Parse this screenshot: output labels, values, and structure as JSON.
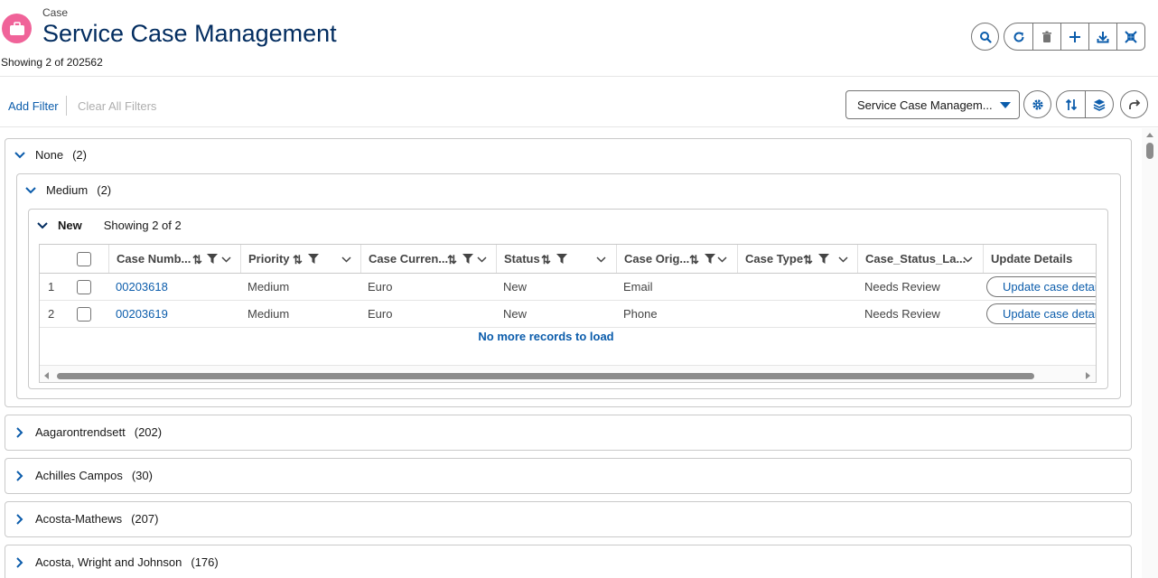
{
  "header": {
    "object_label": "Case",
    "title": "Service Case Management",
    "showing": "Showing 2 of 202562",
    "actions": [
      "search-icon",
      "refresh-icon",
      "delete-icon",
      "add-icon",
      "download-icon",
      "collapse-icon"
    ]
  },
  "filters": {
    "add_filter": "Add Filter",
    "clear_all": "Clear All Filters",
    "view_selected": "Service Case Managem...",
    "actions": [
      "settings-icon",
      "sort-icon",
      "layers-icon",
      "share-icon"
    ]
  },
  "groups": {
    "top": {
      "name": "None",
      "count": "(2)"
    },
    "sub": {
      "name": "Medium",
      "count": "(2)"
    },
    "status": {
      "name": "New",
      "showing": "Showing 2 of 2"
    }
  },
  "table": {
    "columns": [
      "Case Numb...",
      "Priority",
      "Case Curren...",
      "Status",
      "Case Orig...",
      "Case Type",
      "Case_Status_La...",
      "Update Details"
    ],
    "rows": [
      {
        "num": "1",
        "case_number": "00203618",
        "priority": "Medium",
        "currency": "Euro",
        "status": "New",
        "origin": "Email",
        "type": "",
        "status_label": "Needs Review",
        "update": "Update case details"
      },
      {
        "num": "2",
        "case_number": "00203619",
        "priority": "Medium",
        "currency": "Euro",
        "status": "New",
        "origin": "Phone",
        "type": "",
        "status_label": "Needs Review",
        "update": "Update case details"
      }
    ],
    "no_more": "No more records to load"
  },
  "other_groups": [
    {
      "name": "Aagarontrendsett",
      "count": "(202)"
    },
    {
      "name": "Achilles Campos",
      "count": "(30)"
    },
    {
      "name": "Acosta-Mathews",
      "count": "(207)"
    },
    {
      "name": "Acosta, Wright and Johnson",
      "count": "(176)"
    }
  ],
  "colors": {
    "brand_blue": "#0b5cab",
    "title_navy": "#032d60",
    "case_icon_pink": "#f06399"
  }
}
